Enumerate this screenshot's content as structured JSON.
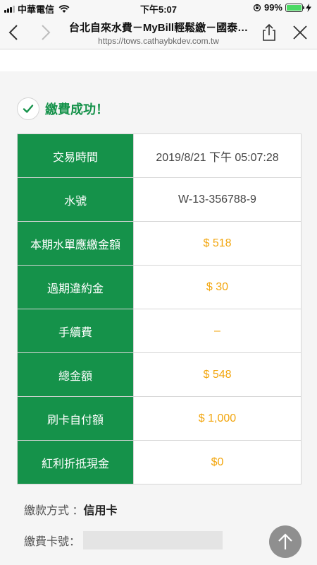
{
  "status_bar": {
    "carrier": "中華電信",
    "time": "下午5:07",
    "battery": "99%"
  },
  "browser": {
    "title": "台北自來水費－MyBill輕鬆繳－國泰…",
    "url": "https://tows.cathaybkdev.com.tw"
  },
  "result": {
    "message": "繳費成功！"
  },
  "rows": [
    {
      "label": "交易時間",
      "value": "2019/8/21 下午 05:07:28"
    },
    {
      "label": "水號",
      "value": "W-13-356788-9"
    },
    {
      "label": "本期水單應繳金額",
      "value": "$ 518"
    },
    {
      "label": "過期違約金",
      "value": "$ 30"
    },
    {
      "label": "手續費",
      "value": "–"
    },
    {
      "label": "總金額",
      "value": "$ 548"
    },
    {
      "label": "刷卡自付額",
      "value": "$ 1,000"
    },
    {
      "label": "紅利折抵現金",
      "value": "$0"
    }
  ],
  "payment": {
    "method_label": "繳款方式 ：",
    "method_value": "信用卡",
    "card_label": "繳費卡號："
  },
  "colors": {
    "green": "#15924a",
    "amount": "#f2a50c"
  },
  "icons": {
    "back": "chevron-left-icon",
    "forward": "chevron-right-icon",
    "share": "share-icon",
    "close": "close-icon",
    "success": "check-icon",
    "scroll_top": "arrow-up-icon"
  }
}
